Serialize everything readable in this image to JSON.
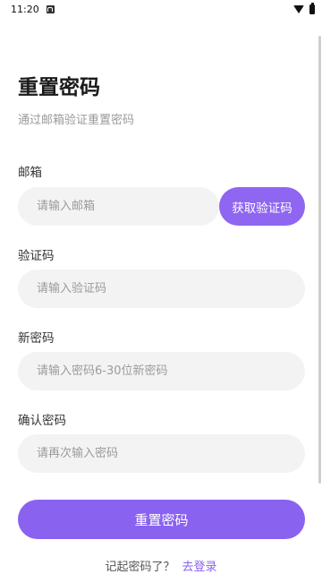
{
  "status_bar": {
    "time": "11:20"
  },
  "header": {
    "title": "重置密码",
    "subtitle": "通过邮箱验证重置密码"
  },
  "form": {
    "email": {
      "label": "邮箱",
      "placeholder": "请输入邮箱",
      "value": ""
    },
    "get_code_button": "获取验证码",
    "code": {
      "label": "验证码",
      "placeholder": "请输入验证码",
      "value": ""
    },
    "new_password": {
      "label": "新密码",
      "placeholder": "请输入密码6-30位新密码",
      "value": ""
    },
    "confirm_password": {
      "label": "确认密码",
      "placeholder": "请再次输入密码",
      "value": ""
    },
    "submit_button": "重置密码"
  },
  "footer": {
    "question": "记起密码了？",
    "login_link": "去登录"
  },
  "colors": {
    "accent": "#8a62f0",
    "field_bg": "#f3f3f4",
    "placeholder": "#9b9b9b"
  }
}
